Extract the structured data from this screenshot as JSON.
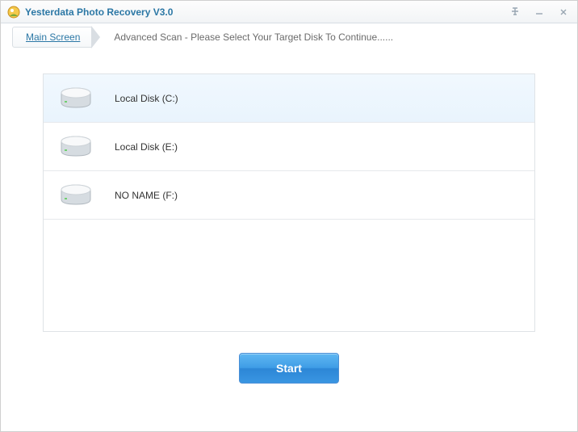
{
  "window": {
    "title": "Yesterdata Photo Recovery V3.0"
  },
  "breadcrumb": {
    "main_label": "Main Screen",
    "subtitle": "Advanced Scan - Please Select Your Target Disk To Continue......"
  },
  "disks": [
    {
      "label": "Local Disk (C:)",
      "selected": true
    },
    {
      "label": "Local Disk (E:)",
      "selected": false
    },
    {
      "label": "NO NAME (F:)",
      "selected": false
    }
  ],
  "actions": {
    "start_label": "Start"
  }
}
